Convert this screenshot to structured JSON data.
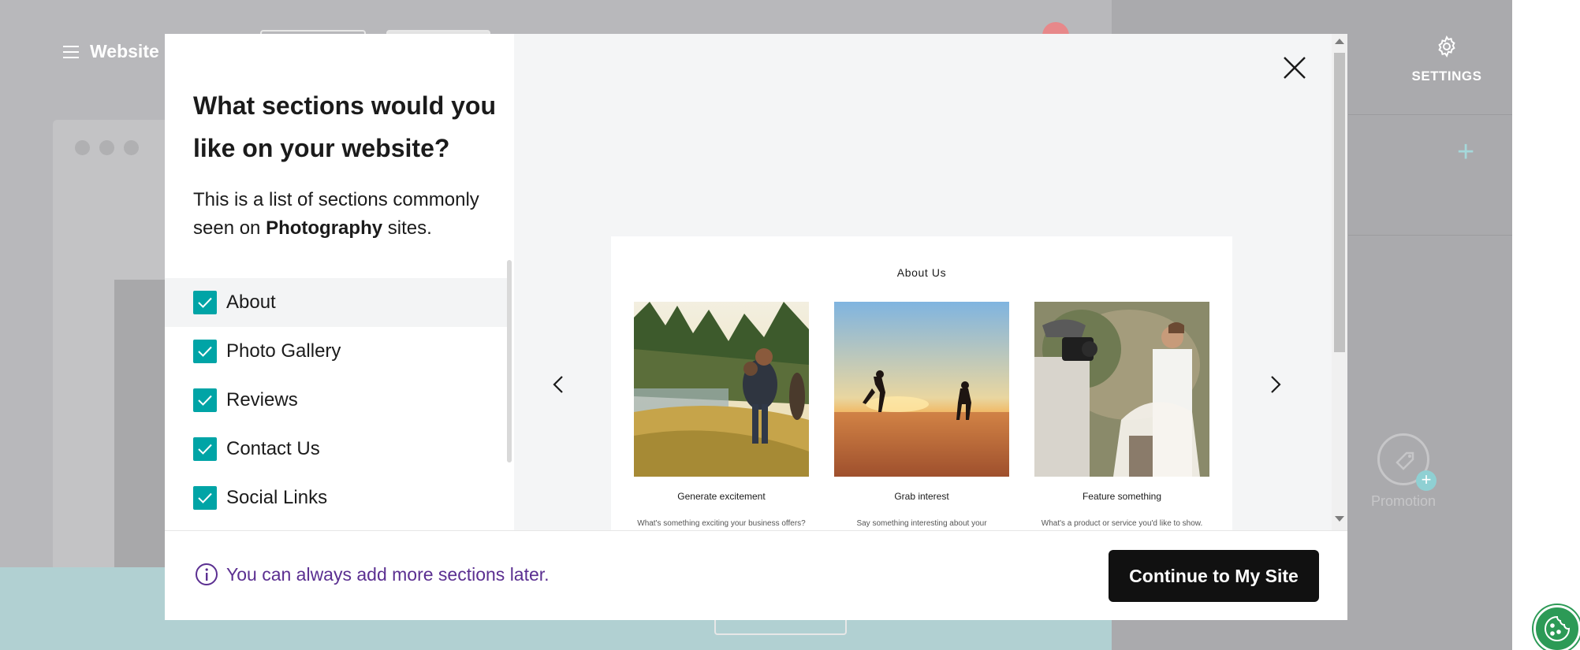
{
  "background": {
    "app_title": "Website",
    "sidebar": {
      "settings_label": "SETTINGS",
      "promotion_label": "Promotion"
    }
  },
  "modal": {
    "title": "What sections would you like on your website?",
    "description_prefix": "This is a list of sections commonly seen on ",
    "description_bold": "Photography",
    "description_suffix": " sites.",
    "sections": [
      {
        "label": "About",
        "checked": true
      },
      {
        "label": "Photo Gallery",
        "checked": true
      },
      {
        "label": "Reviews",
        "checked": true
      },
      {
        "label": "Contact Us",
        "checked": true
      },
      {
        "label": "Social Links",
        "checked": true
      }
    ],
    "preview": {
      "title": "About Us",
      "cards": [
        {
          "title": "Generate excitement",
          "text": "What's something exciting your business offers?"
        },
        {
          "title": "Grab interest",
          "text": "Say something interesting about your"
        },
        {
          "title": "Feature something",
          "text": "What's a product or service you'd like to show."
        }
      ]
    },
    "footer": {
      "note": "You can always add more sections later.",
      "continue_label": "Continue to My Site"
    }
  },
  "colors": {
    "accent_teal": "#00a4a6",
    "note_purple": "#5b2f91",
    "primary_button": "#111111"
  }
}
